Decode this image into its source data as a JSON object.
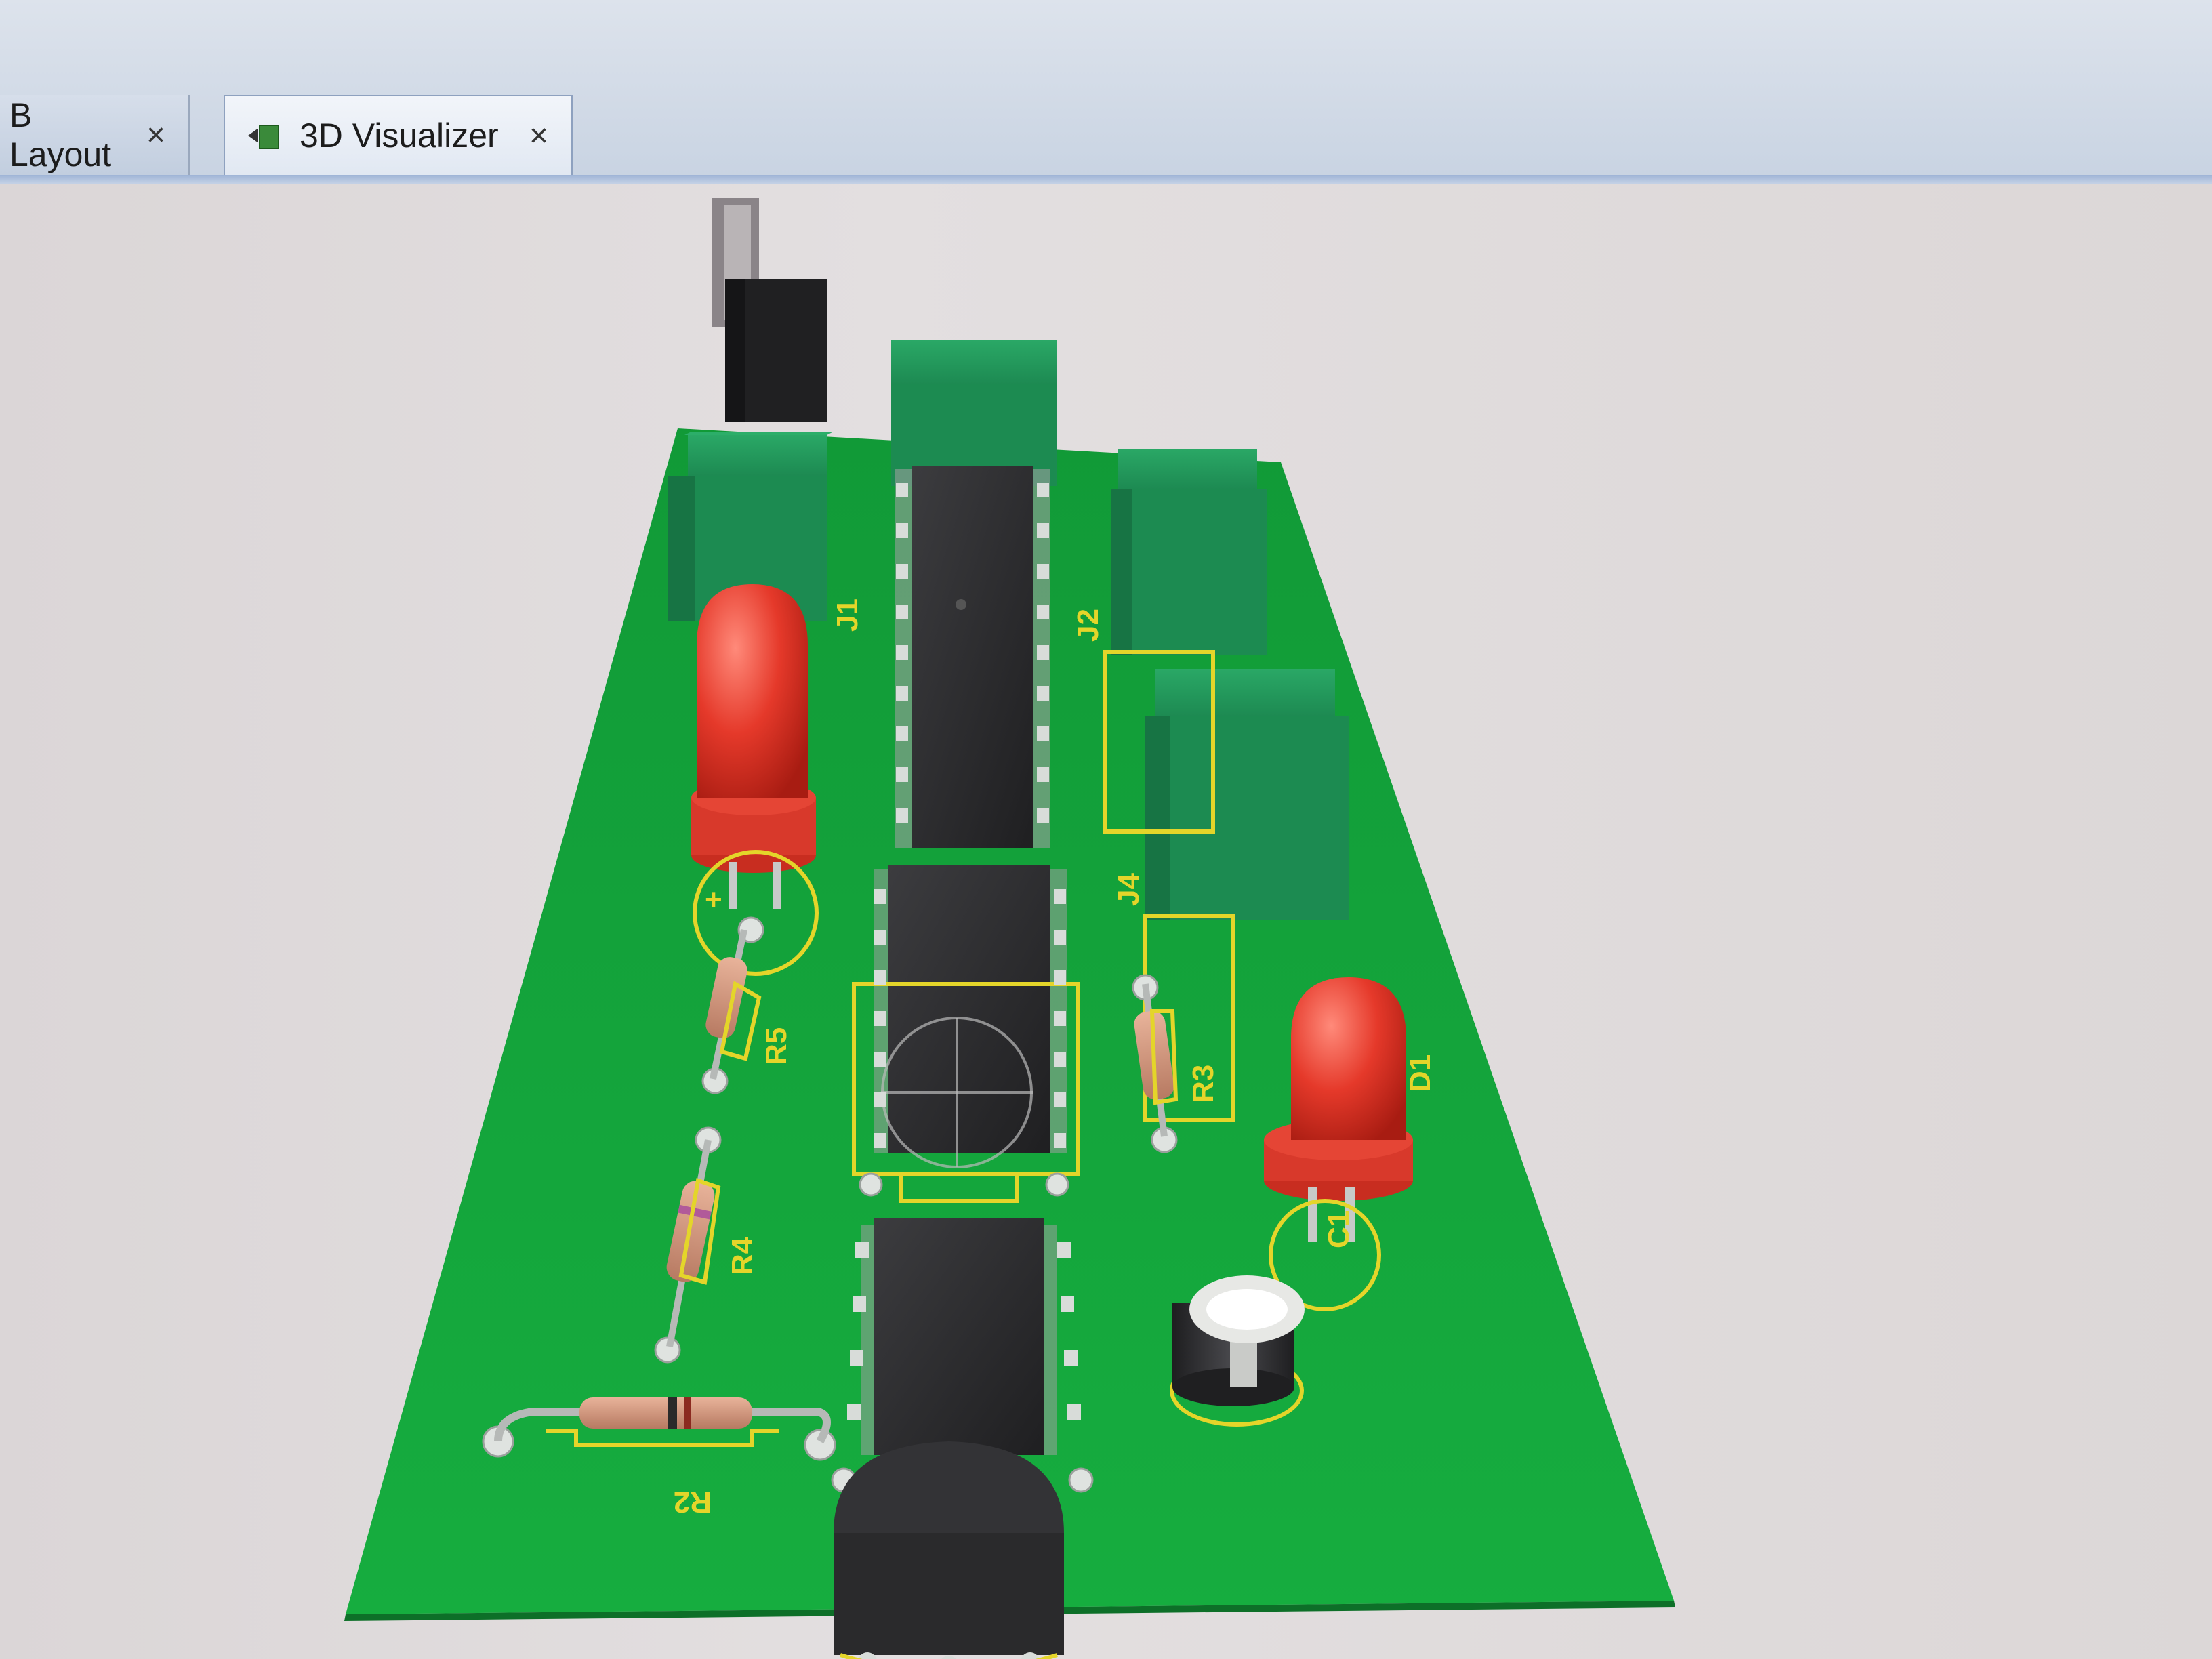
{
  "tabs": [
    {
      "label": "B Layout",
      "active": false,
      "close": "×"
    },
    {
      "label": "3D Visualizer",
      "active": true,
      "close": "×",
      "icon": "3d-visualizer-icon"
    }
  ],
  "board": {
    "labels": {
      "r5": "R5",
      "r4": "R4",
      "r3": "R3",
      "r2": "R2",
      "d1": "D1",
      "c1": "C1",
      "j1": "J1",
      "j2": "J2",
      "j4": "J4",
      "plus": "+"
    },
    "colors": {
      "pcb": "#12a43a",
      "led": "#e23a2a",
      "connector": "#1f8f55",
      "ic": "#2c2c2e",
      "silkscreen": "#e4d52a"
    }
  }
}
